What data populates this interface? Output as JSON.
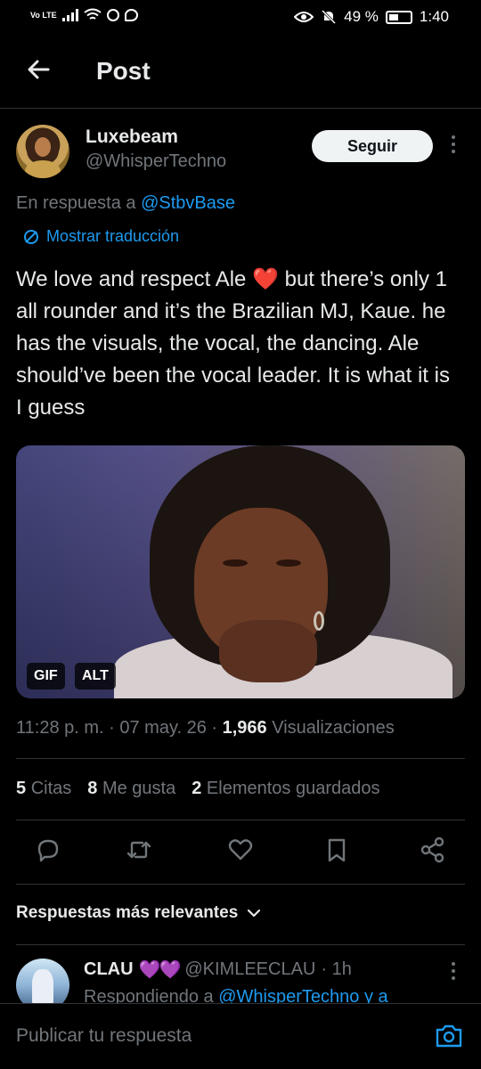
{
  "status_bar": {
    "network": "Vo LTE",
    "battery": "49 %",
    "time": "1:40"
  },
  "header": {
    "title": "Post"
  },
  "tweet": {
    "display_name": "Luxebeam",
    "handle": "@WhisperTechno",
    "follow_label": "Seguir",
    "reply_prefix": "En respuesta a",
    "reply_handle": "@StbvBase",
    "translate_label": "Mostrar traducción",
    "text_before_emoji": "We love and respect Ale",
    "emoji": "❤️",
    "text_after_emoji": "but there’s only 1 all rounder and it’s the Brazilian MJ, Kaue. he has the visuals, the vocal, the dancing. Ale should’ve been the vocal leader. It is what it is I guess",
    "media_badges": [
      "GIF",
      "ALT"
    ],
    "time": "11:28 p. m.",
    "date": "07 may. 26",
    "views_count": "1,966",
    "views_label": "Visualizaciones",
    "stats": [
      {
        "count": "5",
        "label": "Citas"
      },
      {
        "count": "8",
        "label": "Me gusta"
      },
      {
        "count": "2",
        "label": "Elementos guardados"
      }
    ]
  },
  "actions": [
    "reply-icon",
    "retweet-icon",
    "like-icon",
    "bookmark-icon",
    "share-icon"
  ],
  "replies": {
    "sort_label": "Respuestas más relevantes",
    "first": {
      "name": "CLAU",
      "hearts": "💜💜",
      "handle": "@KIMLEECLAU",
      "time": "· 1h",
      "sub_prefix": "Respondiendo a",
      "sub_handle": "@WhisperTechno y a"
    }
  },
  "composer": {
    "placeholder": "Publicar tu respuesta"
  },
  "colors": {
    "background": "#000000",
    "accent": "#1d9bf0",
    "muted": "#71767b",
    "text": "#e7e9ea"
  }
}
